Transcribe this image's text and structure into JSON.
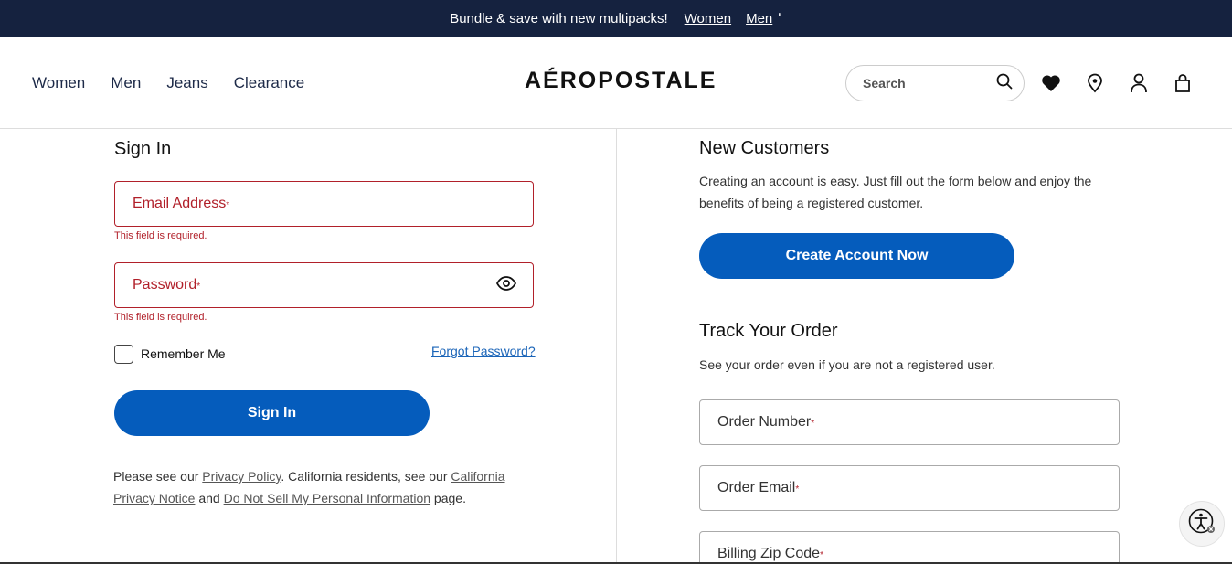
{
  "promo": {
    "message": "Bundle & save with new multipacks!",
    "link_women": "Women",
    "link_men": "Men",
    "pause_glyph": "⏸"
  },
  "header": {
    "nav": [
      "Women",
      "Men",
      "Jeans",
      "Clearance"
    ],
    "logo": "AÉROPOSTALE",
    "search_placeholder": "Search"
  },
  "signin": {
    "title": "Sign In",
    "email_label": "Email Address",
    "password_label": "Password",
    "required_marker": "*",
    "error_text": "This field is required.",
    "remember_label": "Remember Me",
    "forgot_link": "Forgot Password?",
    "button": "Sign In",
    "privacy_prefix": "Please see our ",
    "privacy_link": "Privacy Policy",
    "privacy_mid": ". California residents, see our ",
    "ca_link": "California Privacy Notice",
    "privacy_and": " and ",
    "dns_link": "Do Not Sell My Personal Information",
    "privacy_suffix": " page."
  },
  "new_customers": {
    "title": "New Customers",
    "description": "Creating an account is easy. Just fill out the form below and enjoy the benefits of being a registered customer.",
    "button": "Create Account Now"
  },
  "track_order": {
    "title": "Track Your Order",
    "description": "See your order even if you are not a registered user.",
    "order_number_label": "Order Number",
    "order_email_label": "Order Email",
    "billing_zip_label": "Billing Zip Code"
  },
  "colors": {
    "promo_bg": "#15223f",
    "primary_button": "#055cbc",
    "error": "#b1202a"
  }
}
